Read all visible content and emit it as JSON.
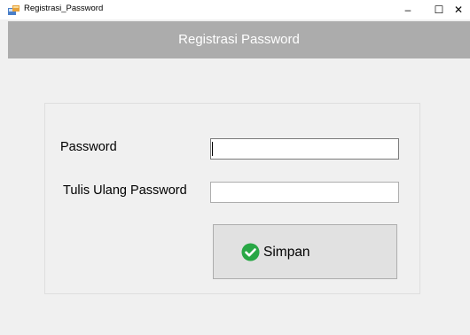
{
  "window": {
    "title": "Registrasi_Password",
    "minimize_glyph": "–",
    "maximize_glyph": "☐",
    "close_glyph": "✕"
  },
  "header": {
    "title": "Registrasi Password"
  },
  "form": {
    "password_label": "Password",
    "password_value": "",
    "retype_label": "Tulis Ulang Password",
    "retype_value": "",
    "save_label": "Simpan",
    "save_icon": "check-circle-icon"
  },
  "colors": {
    "header_bg": "#acacac",
    "header_text": "#ffffff",
    "window_bg": "#f0f0f0",
    "button_bg": "#e1e1e1",
    "check_green": "#28a745"
  }
}
